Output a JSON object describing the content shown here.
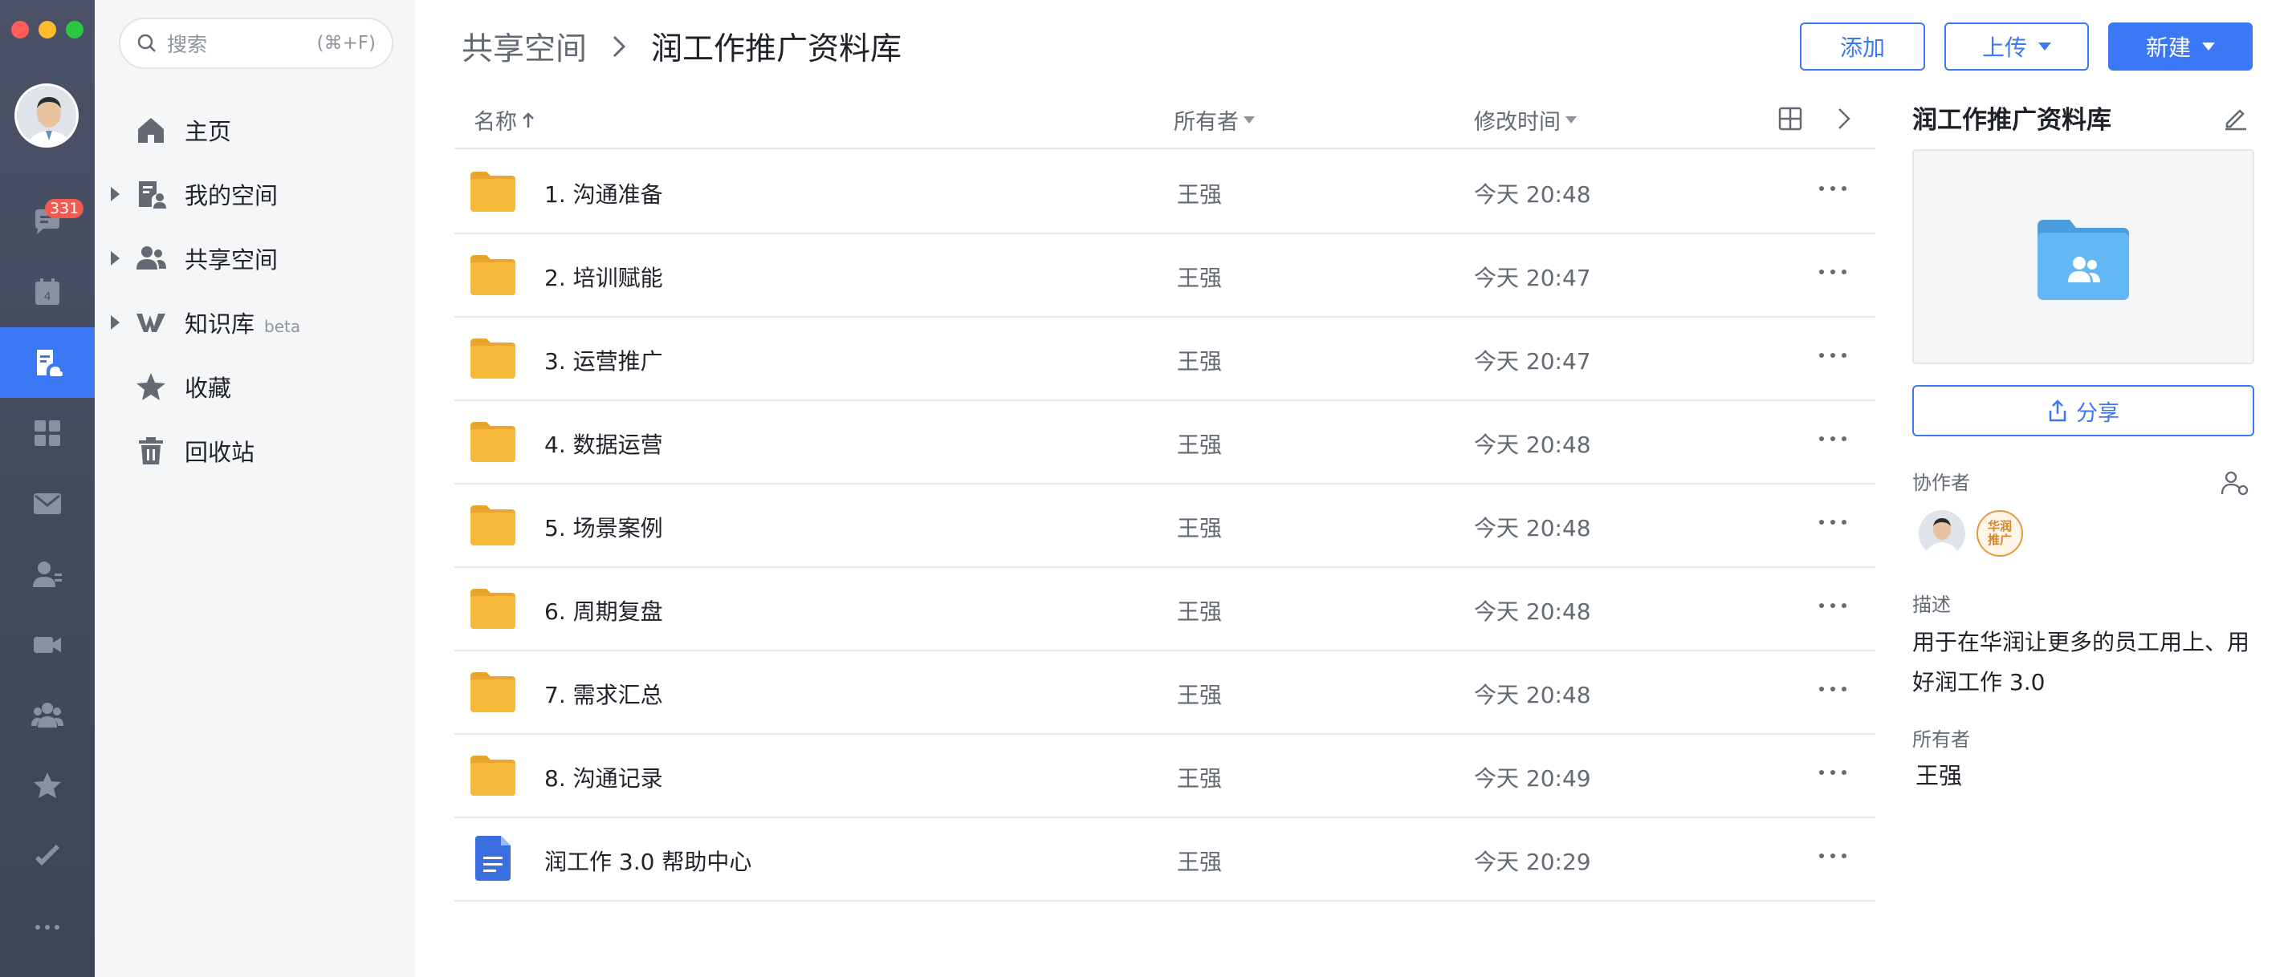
{
  "rail": {
    "badge_count": "331",
    "calendar_day": "4",
    "items": [
      "chat-icon",
      "calendar-icon",
      "docs-icon",
      "workspace-icon",
      "mail-icon",
      "contacts-icon",
      "video-icon",
      "team-icon",
      "favorite-icon",
      "tasks-icon",
      "more-icon"
    ],
    "active": "docs-icon"
  },
  "search": {
    "placeholder": "搜索",
    "shortcut": "(⌘+F)"
  },
  "nav": {
    "items": [
      {
        "label": "主页",
        "icon": "home-icon"
      },
      {
        "label": "我的空间",
        "icon": "my-space-icon"
      },
      {
        "label": "共享空间",
        "icon": "shared-space-icon"
      },
      {
        "label": "知识库",
        "icon": "wiki-icon",
        "tag": "beta"
      },
      {
        "label": "收藏",
        "icon": "star-icon"
      },
      {
        "label": "回收站",
        "icon": "trash-icon"
      }
    ]
  },
  "breadcrumb": {
    "parent": "共享空间",
    "current": "润工作推广资料库"
  },
  "toolbar": {
    "add_label": "添加",
    "upload_label": "上传",
    "new_label": "新建"
  },
  "table": {
    "columns": {
      "name": "名称",
      "owner": "所有者",
      "modified": "修改时间"
    },
    "rows": [
      {
        "name": "1. 沟通准备",
        "owner": "王强",
        "time": "今天 20:48",
        "type": "folder"
      },
      {
        "name": "2. 培训赋能",
        "owner": "王强",
        "time": "今天 20:47",
        "type": "folder"
      },
      {
        "name": "3. 运营推广",
        "owner": "王强",
        "time": "今天 20:47",
        "type": "folder"
      },
      {
        "name": "4. 数据运营",
        "owner": "王强",
        "time": "今天 20:48",
        "type": "folder"
      },
      {
        "name": "5. 场景案例",
        "owner": "王强",
        "time": "今天 20:48",
        "type": "folder"
      },
      {
        "name": "6. 周期复盘",
        "owner": "王强",
        "time": "今天 20:48",
        "type": "folder"
      },
      {
        "name": "7. 需求汇总",
        "owner": "王强",
        "time": "今天 20:48",
        "type": "folder"
      },
      {
        "name": "8. 沟通记录",
        "owner": "王强",
        "time": "今天 20:49",
        "type": "folder"
      },
      {
        "name": "润工作 3.0 帮助中心",
        "owner": "王强",
        "time": "今天 20:29",
        "type": "doc"
      }
    ]
  },
  "info": {
    "title": "润工作推广资料库",
    "share_label": "分享",
    "collaborators_label": "协作者",
    "collaborator_badge": "华润推广",
    "description_label": "描述",
    "description": "用于在华润让更多的员工用上、用好润工作 3.0",
    "owner_label": "所有者",
    "owner": "王强"
  },
  "colors": {
    "accent": "#3b78f6",
    "rail_bg": "#464c60",
    "folder": "#f6b93b",
    "doc": "#3b6fe0",
    "badge": "#f05a4f"
  }
}
